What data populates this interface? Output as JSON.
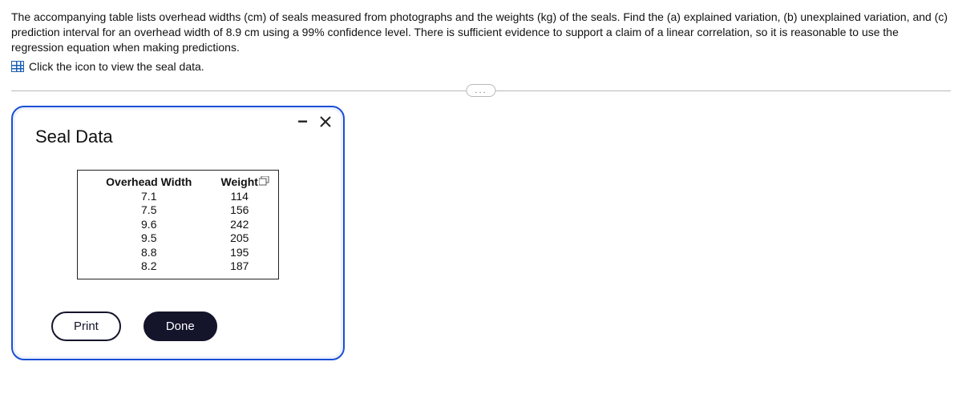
{
  "problem": {
    "text": "The accompanying table lists overhead widths (cm) of seals measured from photographs and the weights (kg) of the seals. Find the (a) explained variation, (b) unexplained variation, and (c) prediction interval for an overhead width of 8.9 cm using a 99% confidence level. There is sufficient evidence to support a claim of a linear correlation, so it is reasonable to use the regression equation when making predictions.",
    "link_text": "Click the icon to view the seal data."
  },
  "divider": {
    "pill": "..."
  },
  "modal": {
    "title": "Seal Data",
    "table": {
      "headers": {
        "col1": "Overhead Width",
        "col2": "Weight"
      },
      "rows": [
        {
          "w": "7.1",
          "kg": "114"
        },
        {
          "w": "7.5",
          "kg": "156"
        },
        {
          "w": "9.6",
          "kg": "242"
        },
        {
          "w": "9.5",
          "kg": "205"
        },
        {
          "w": "8.8",
          "kg": "195"
        },
        {
          "w": "8.2",
          "kg": "187"
        }
      ]
    },
    "buttons": {
      "print": "Print",
      "done": "Done"
    }
  }
}
